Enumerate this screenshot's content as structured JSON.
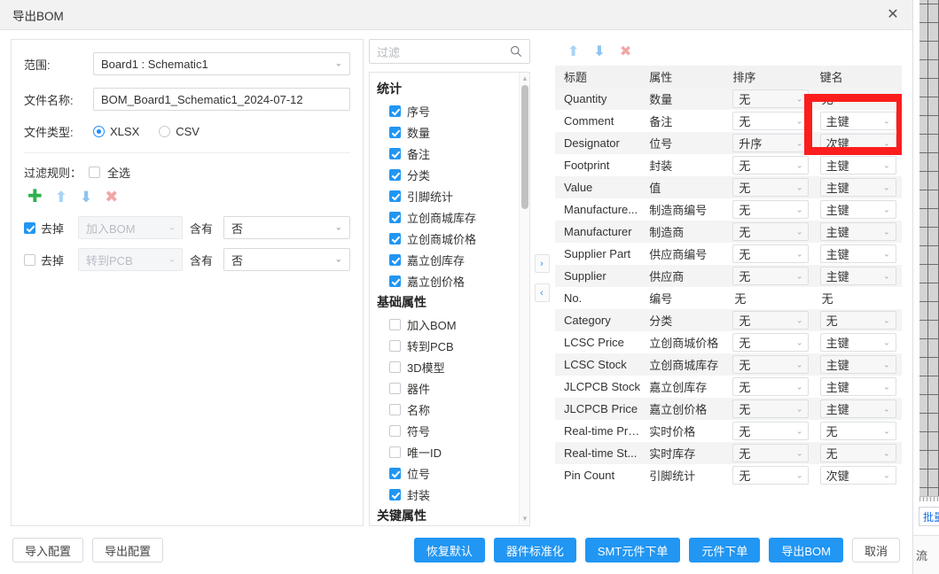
{
  "window": {
    "title": "导出BOM",
    "close_icon": "close-icon"
  },
  "form": {
    "scope_label": "范围:",
    "scope_value": "Board1 : Schematic1",
    "filename_label": "文件名称:",
    "filename_value": "BOM_Board1_Schematic1_2024-07-12",
    "filetype_label": "文件类型:",
    "filetype_options": [
      {
        "label": "XLSX",
        "checked": true
      },
      {
        "label": "CSV",
        "checked": false
      }
    ]
  },
  "filter_rules": {
    "label": "过滤规则：",
    "select_all_label": "全选",
    "select_all_checked": false,
    "toolbar": [
      {
        "name": "add-rule-icon",
        "glyph": "✚",
        "color": "#2bb24c"
      },
      {
        "name": "move-up-icon",
        "glyph": "⬆",
        "color": "#a9d4f5"
      },
      {
        "name": "move-down-icon",
        "glyph": "⬇",
        "color": "#8ec4ef"
      },
      {
        "name": "delete-rule-icon",
        "glyph": "✖",
        "color": "#f2a6a6"
      }
    ],
    "rows": [
      {
        "checked": true,
        "action_label": "去掉",
        "field": "加入BOM",
        "operator": "含有",
        "value": "否"
      },
      {
        "checked": false,
        "action_label": "去掉",
        "field": "转到PCB",
        "operator": "含有",
        "value": "否"
      }
    ]
  },
  "search": {
    "placeholder": "过滤",
    "icon": "search-icon"
  },
  "tree": {
    "groups": [
      {
        "title": "统计",
        "items": [
          {
            "label": "序号",
            "checked": true
          },
          {
            "label": "数量",
            "checked": true
          },
          {
            "label": "备注",
            "checked": true
          },
          {
            "label": "分类",
            "checked": true
          },
          {
            "label": "引脚统计",
            "checked": true
          },
          {
            "label": "立创商城库存",
            "checked": true
          },
          {
            "label": "立创商城价格",
            "checked": true
          },
          {
            "label": "嘉立创库存",
            "checked": true
          },
          {
            "label": "嘉立创价格",
            "checked": true
          }
        ]
      },
      {
        "title": "基础属性",
        "items": [
          {
            "label": "加入BOM",
            "checked": false
          },
          {
            "label": "转到PCB",
            "checked": false
          },
          {
            "label": "3D模型",
            "checked": false
          },
          {
            "label": "器件",
            "checked": false
          },
          {
            "label": "名称",
            "checked": false
          },
          {
            "label": "符号",
            "checked": false
          },
          {
            "label": "唯一ID",
            "checked": false
          },
          {
            "label": "位号",
            "checked": true
          },
          {
            "label": "封装",
            "checked": true
          }
        ]
      },
      {
        "title": "关键属性",
        "items": []
      }
    ]
  },
  "transfer_arrows": [
    {
      "name": "move-right-button",
      "glyph": "›"
    },
    {
      "name": "move-left-button",
      "glyph": "‹"
    }
  ],
  "right_toolbar": [
    {
      "name": "row-up-icon",
      "glyph": "⬆",
      "color": "#a9d4f5"
    },
    {
      "name": "row-down-icon",
      "glyph": "⬇",
      "color": "#8ec4ef"
    },
    {
      "name": "row-delete-icon",
      "glyph": "✖",
      "color": "#f4a3a3"
    }
  ],
  "table": {
    "headers": [
      "标题",
      "属性",
      "排序",
      "键名"
    ],
    "rows": [
      {
        "title": "Quantity",
        "attr": "数量",
        "sort": "无",
        "sort_type": "select",
        "key": "无",
        "key_type": "text"
      },
      {
        "title": "Comment",
        "attr": "备注",
        "sort": "无",
        "sort_type": "select",
        "key": "主键",
        "key_type": "select"
      },
      {
        "title": "Designator",
        "attr": "位号",
        "sort": "升序",
        "sort_type": "select",
        "key": "次键",
        "key_type": "select"
      },
      {
        "title": "Footprint",
        "attr": "封装",
        "sort": "无",
        "sort_type": "select",
        "key": "主键",
        "key_type": "select"
      },
      {
        "title": "Value",
        "attr": "值",
        "sort": "无",
        "sort_type": "select",
        "key": "主键",
        "key_type": "select"
      },
      {
        "title": "Manufacture...",
        "attr": "制造商编号",
        "sort": "无",
        "sort_type": "select",
        "key": "主键",
        "key_type": "select"
      },
      {
        "title": "Manufacturer",
        "attr": "制造商",
        "sort": "无",
        "sort_type": "select",
        "key": "主键",
        "key_type": "select"
      },
      {
        "title": "Supplier Part",
        "attr": "供应商编号",
        "sort": "无",
        "sort_type": "select",
        "key": "主键",
        "key_type": "select"
      },
      {
        "title": "Supplier",
        "attr": "供应商",
        "sort": "无",
        "sort_type": "select",
        "key": "主键",
        "key_type": "select"
      },
      {
        "title": "No.",
        "attr": "编号",
        "sort": "无",
        "sort_type": "text",
        "key": "无",
        "key_type": "text"
      },
      {
        "title": "Category",
        "attr": "分类",
        "sort": "无",
        "sort_type": "select",
        "key": "无",
        "key_type": "select"
      },
      {
        "title": "LCSC Price",
        "attr": "立创商城价格",
        "sort": "无",
        "sort_type": "select",
        "key": "主键",
        "key_type": "select"
      },
      {
        "title": "LCSC Stock",
        "attr": "立创商城库存",
        "sort": "无",
        "sort_type": "select",
        "key": "主键",
        "key_type": "select"
      },
      {
        "title": "JLCPCB Stock",
        "attr": "嘉立创库存",
        "sort": "无",
        "sort_type": "select",
        "key": "主键",
        "key_type": "select"
      },
      {
        "title": "JLCPCB Price",
        "attr": "嘉立创价格",
        "sort": "无",
        "sort_type": "select",
        "key": "主键",
        "key_type": "select"
      },
      {
        "title": "Real-time Price",
        "attr": "实时价格",
        "sort": "无",
        "sort_type": "select",
        "key": "无",
        "key_type": "select"
      },
      {
        "title": "Real-time St...",
        "attr": "实时库存",
        "sort": "无",
        "sort_type": "select",
        "key": "无",
        "key_type": "select"
      },
      {
        "title": "Pin Count",
        "attr": "引脚统计",
        "sort": "无",
        "sort_type": "select",
        "key": "次键",
        "key_type": "select"
      }
    ]
  },
  "highlight": {
    "color": "#fc1d1d",
    "note": "红色框标注 Comment 与 Designator 行的键名单元格"
  },
  "footer": {
    "left_buttons": [
      {
        "label": "导入配置",
        "style": "ghost"
      },
      {
        "label": "导出配置",
        "style": "ghost"
      }
    ],
    "right_buttons": [
      {
        "label": "恢复默认",
        "style": "primary"
      },
      {
        "label": "器件标准化",
        "style": "primary"
      },
      {
        "label": "SMT元件下单",
        "style": "primary"
      },
      {
        "label": "元件下单",
        "style": "primary"
      },
      {
        "label": "导出BOM",
        "style": "primary"
      },
      {
        "label": "取消",
        "style": "ghost"
      }
    ]
  },
  "background": {
    "batch_label": "批量",
    "tab_label": "流"
  }
}
